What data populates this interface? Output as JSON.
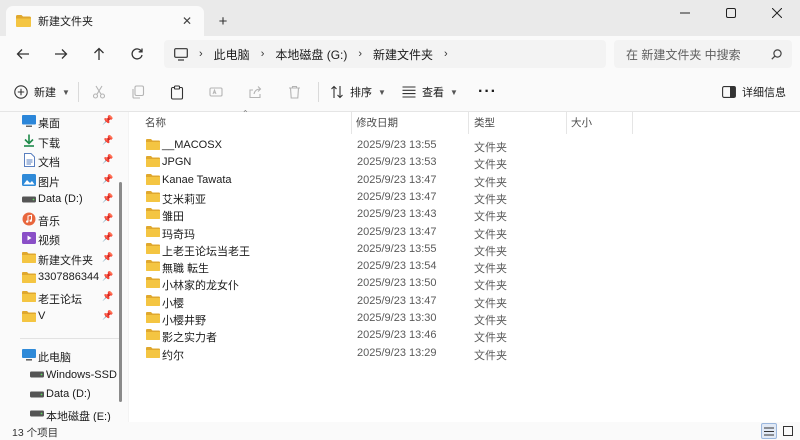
{
  "tab": {
    "title": "新建文件夹",
    "close": "✕",
    "new_tab": "+"
  },
  "window": {
    "minimize": "—",
    "maximize": "☐",
    "close": "✕"
  },
  "address": {
    "segments": [
      "此电脑",
      "本地磁盘 (G:)",
      "新建文件夹"
    ],
    "separator": "›",
    "search_placeholder": "在 新建文件夹 中搜索"
  },
  "toolbar": {
    "new_label": "新建",
    "sort_label": "排序",
    "view_label": "查看",
    "more_label": "···",
    "details_label": "详细信息"
  },
  "sidebar": {
    "quick_access": [
      {
        "label": "桌面",
        "icon": "desktop-icon"
      },
      {
        "label": "下载",
        "icon": "download-icon"
      },
      {
        "label": "文档",
        "icon": "document-icon"
      },
      {
        "label": "图片",
        "icon": "picture-icon"
      },
      {
        "label": "Data (D:)",
        "icon": "drive-icon"
      },
      {
        "label": "音乐",
        "icon": "music-icon"
      },
      {
        "label": "视频",
        "icon": "video-icon"
      },
      {
        "label": "新建文件夹",
        "icon": "folder-icon"
      },
      {
        "label": "3307886344",
        "icon": "folder-icon"
      },
      {
        "label": "老王论坛",
        "icon": "folder-icon"
      },
      {
        "label": "V",
        "icon": "folder-icon"
      }
    ],
    "this_pc": [
      {
        "label": "此电脑",
        "icon": "computer-icon"
      },
      {
        "label": "Windows-SSD",
        "icon": "drive-icon"
      },
      {
        "label": "Data (D:)",
        "icon": "drive-icon"
      },
      {
        "label": "本地磁盘 (E:)",
        "icon": "drive-icon"
      }
    ]
  },
  "columns": {
    "name": "名称",
    "modified": "修改日期",
    "type": "类型",
    "size": "大小"
  },
  "files": [
    {
      "name": "__MACOSX",
      "modified": "2025/9/23 13:55",
      "type": "文件夹"
    },
    {
      "name": "JPGN",
      "modified": "2025/9/23 13:53",
      "type": "文件夹"
    },
    {
      "name": "Kanae Tawata",
      "modified": "2025/9/23 13:47",
      "type": "文件夹"
    },
    {
      "name": "艾米莉亚",
      "modified": "2025/9/23 13:47",
      "type": "文件夹"
    },
    {
      "name": "雏田",
      "modified": "2025/9/23 13:43",
      "type": "文件夹"
    },
    {
      "name": "玛奇玛",
      "modified": "2025/9/23 13:47",
      "type": "文件夹"
    },
    {
      "name": "上老王论坛当老王",
      "modified": "2025/9/23 13:55",
      "type": "文件夹"
    },
    {
      "name": "無職 転生",
      "modified": "2025/9/23 13:54",
      "type": "文件夹"
    },
    {
      "name": "小林家的龙女仆",
      "modified": "2025/9/23 13:50",
      "type": "文件夹"
    },
    {
      "name": "小樱",
      "modified": "2025/9/23 13:47",
      "type": "文件夹"
    },
    {
      "name": "小樱井野",
      "modified": "2025/9/23 13:30",
      "type": "文件夹"
    },
    {
      "name": "影之实力者",
      "modified": "2025/9/23 13:46",
      "type": "文件夹"
    },
    {
      "name": "约尔",
      "modified": "2025/9/23 13:29",
      "type": "文件夹"
    }
  ],
  "status": {
    "item_count": "13 个项目"
  },
  "colors": {
    "folder": "#f4c542",
    "folder_dark": "#e0a82e",
    "accent": "#0067c0"
  }
}
